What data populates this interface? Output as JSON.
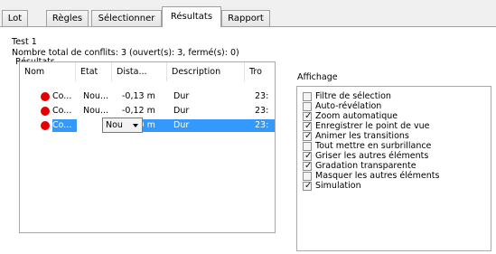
{
  "tabs": [
    {
      "label": "Lot",
      "active": false
    },
    {
      "label": "Règles",
      "active": false
    },
    {
      "label": "Sélectionner",
      "active": false
    },
    {
      "label": "Résultats",
      "active": true
    },
    {
      "label": "Rapport",
      "active": false
    }
  ],
  "test_name": "Test 1",
  "conflicts_summary": "Nombre total de conflits: 3 (ouvert(s): 3, fermé(s): 0)",
  "results": {
    "group_label": "Résultats",
    "columns": [
      "Nom",
      "Etat",
      "Dista...",
      "Description",
      "Tro"
    ],
    "rows": [
      {
        "name": "Co...",
        "state": "Nou...",
        "distance": "-0,13 m",
        "description": "Dur",
        "found": "23:",
        "status_color": "#e40000",
        "selected": false
      },
      {
        "name": "Co...",
        "state": "Nou...",
        "distance": "-0,12 m",
        "description": "Dur",
        "found": "23:",
        "status_color": "#e40000",
        "selected": false
      },
      {
        "name": "Co...",
        "state": "Nou",
        "distance": "-0,10 m",
        "description": "Dur",
        "found": "23:",
        "status_color": "#e40000",
        "selected": true
      }
    ],
    "selection_color": "#3399ff"
  },
  "display": {
    "group_label": "Affichage",
    "options": [
      {
        "label": "Filtre de sélection",
        "checked": false
      },
      {
        "label": "Auto-révélation",
        "checked": false
      },
      {
        "label": "Zoom automatique",
        "checked": true
      },
      {
        "label": "Enregistrer le point de vue",
        "checked": true
      },
      {
        "label": "Animer les transitions",
        "checked": true
      },
      {
        "label": "Tout mettre en surbrillance",
        "checked": false
      },
      {
        "label": "Griser les autres éléments",
        "checked": true
      },
      {
        "label": "Gradation transparente",
        "checked": true
      },
      {
        "label": "Masquer les autres éléments",
        "checked": false
      },
      {
        "label": "Simulation",
        "checked": true
      }
    ]
  }
}
